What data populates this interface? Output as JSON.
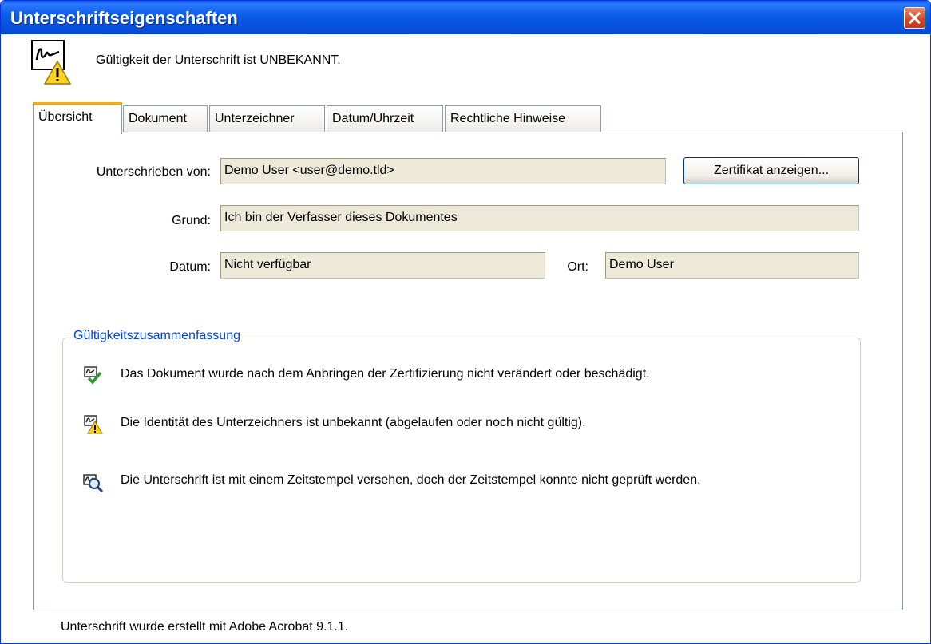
{
  "window": {
    "title": "Unterschriftseigenschaften"
  },
  "header": {
    "status_text": "Gültigkeit der Unterschrift ist UNBEKANNT.",
    "icon": "signature-warning-icon"
  },
  "tabs": [
    {
      "label": "Übersicht",
      "active": true
    },
    {
      "label": "Dokument",
      "active": false
    },
    {
      "label": "Unterzeichner",
      "active": false
    },
    {
      "label": "Datum/Uhrzeit",
      "active": false
    },
    {
      "label": "Rechtliche Hinweise",
      "active": false
    }
  ],
  "overview": {
    "signed_by_label": "Unterschrieben von:",
    "signed_by_value": "Demo User <user@demo.tld>",
    "show_certificate_button": "Zertifikat anzeigen...",
    "reason_label": "Grund:",
    "reason_value": "Ich bin der Verfasser dieses Dokumentes",
    "date_label": "Datum:",
    "date_value": "Nicht verfügbar",
    "location_label": "Ort:",
    "location_value": "Demo User"
  },
  "summary": {
    "title": "Gültigkeitszusammenfassung",
    "items": [
      {
        "icon": "document-valid-icon",
        "text": "Das Dokument wurde nach dem Anbringen der Zertifizierung nicht verändert oder beschädigt."
      },
      {
        "icon": "identity-warning-icon",
        "text": "Die Identität des Unterzeichners ist unbekannt (abgelaufen oder noch nicht gültig)."
      },
      {
        "icon": "timestamp-magnifier-icon",
        "text": "Die Unterschrift ist mit einem Zeitstempel versehen, doch der Zeitstempel konnte nicht geprüft werden."
      }
    ]
  },
  "footer": {
    "text": "Unterschrift wurde erstellt mit Adobe Acrobat 9.1.1."
  },
  "colors": {
    "titlebar": "#0a5ff0",
    "legend": "#0046d5",
    "field_bg": "#ece9d8",
    "close_button": "#d2472b",
    "active_tab_accent": "#f5a623"
  }
}
